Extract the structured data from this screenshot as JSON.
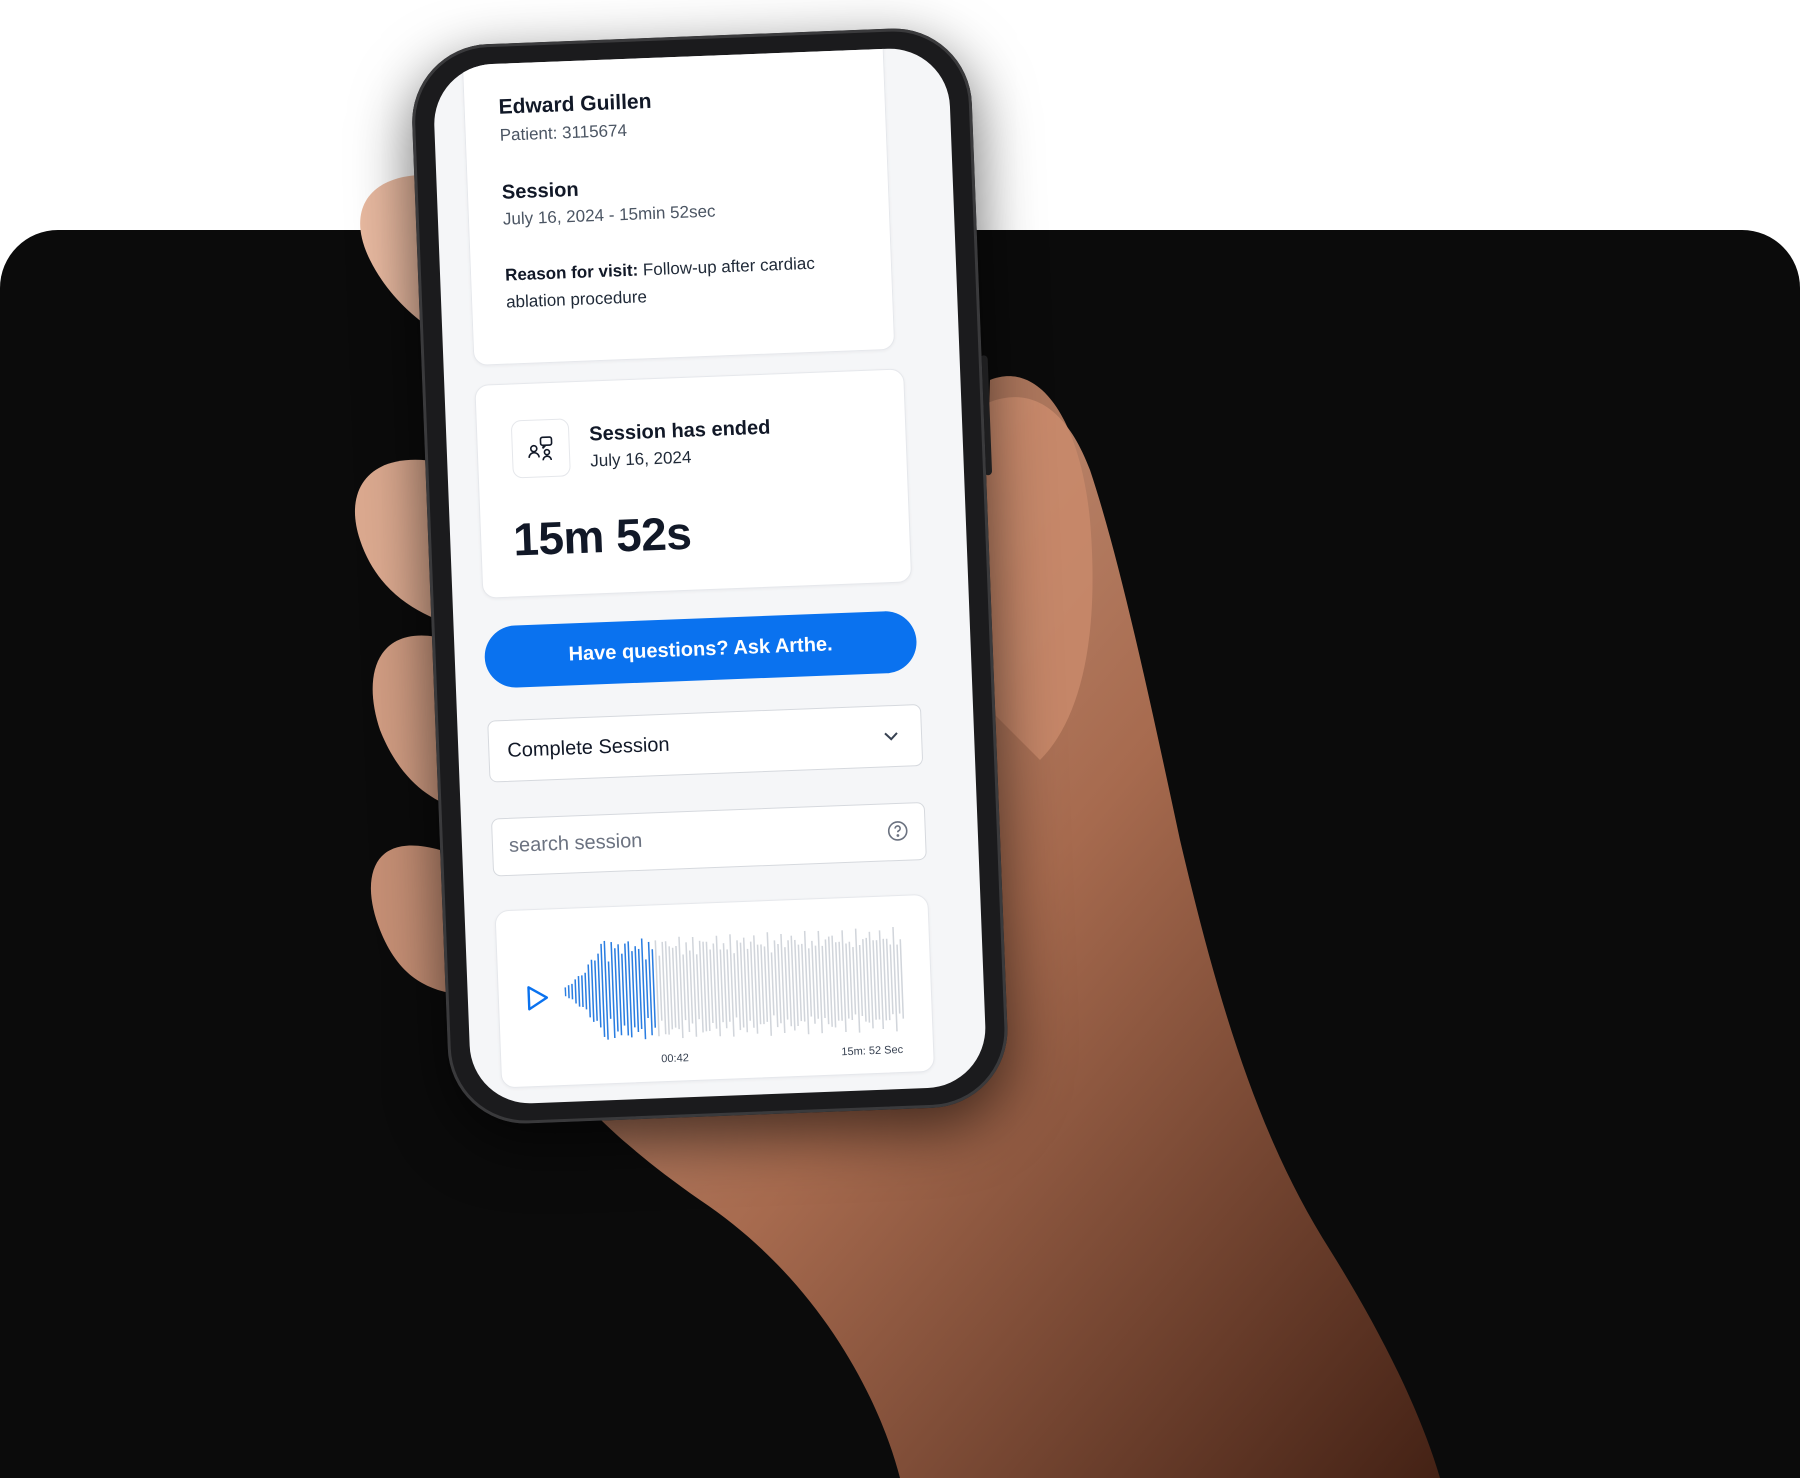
{
  "patient": {
    "name": "Edward Guillen",
    "id_label": "Patient: 3115674"
  },
  "session": {
    "heading": "Session",
    "meta": "July 16, 2024 - 15min 52sec",
    "reason_label": "Reason for visit:",
    "reason_text": "Follow-up after cardiac ablation procedure"
  },
  "status": {
    "icon": "people-chat-icon",
    "title": "Session has ended",
    "date": "July 16, 2024",
    "duration": "15m 52s"
  },
  "ask_button": {
    "label": "Have questions? Ask Arthe."
  },
  "session_select": {
    "value": "Complete Session"
  },
  "search": {
    "placeholder": "search session",
    "value": ""
  },
  "player": {
    "current_time": "00:42",
    "total_time": "15m: 52 Sec",
    "progress": 0.27
  },
  "colors": {
    "accent": "#0a72ef",
    "wave_played": "#2a7de1",
    "wave_unplayed": "#d1d5db",
    "background_dark": "#0b0b0b"
  }
}
